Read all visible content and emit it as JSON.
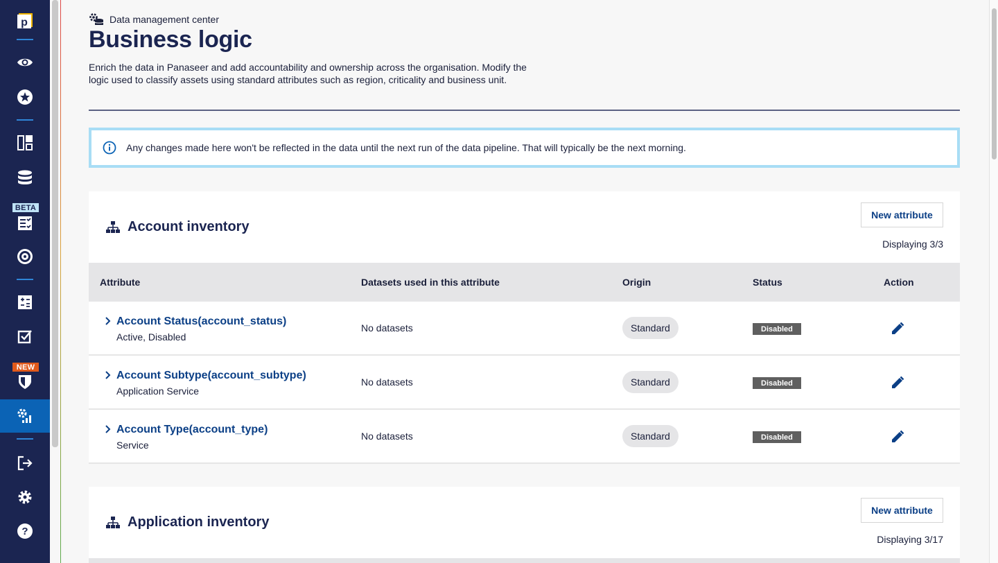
{
  "header": {
    "breadcrumb": "Data management center",
    "title": "Business logic",
    "description": "Enrich the data in Panaseer and add accountability and ownership across the organisation. Modify the logic used to classify assets using standard attributes such as region, criticality and business unit."
  },
  "info": {
    "message": "Any changes made here won't be reflected in the data until the next run of the data pipeline. That will typically be the next morning.",
    "icon": "info-icon"
  },
  "sidebar": {
    "logo_letter": "p",
    "beta_badge": "BETA",
    "new_badge": "NEW",
    "items": [
      {
        "icon": "eye-icon"
      },
      {
        "icon": "star-icon"
      },
      {
        "icon": "dashboard-icon"
      },
      {
        "icon": "database-icon"
      },
      {
        "icon": "checklist-icon"
      },
      {
        "icon": "target-icon"
      },
      {
        "icon": "calculator-icon"
      },
      {
        "icon": "checkbox-icon"
      },
      {
        "icon": "shield-icon"
      },
      {
        "icon": "data-management-icon"
      },
      {
        "icon": "logout-icon"
      },
      {
        "icon": "gear-icon"
      },
      {
        "icon": "help-icon"
      }
    ]
  },
  "table_columns": {
    "attribute": "Attribute",
    "datasets": "Datasets used in this attribute",
    "origin": "Origin",
    "status": "Status",
    "action": "Action"
  },
  "cards": [
    {
      "title": "Account inventory",
      "button": "New attribute",
      "count": "Displaying 3/3",
      "rows": [
        {
          "name": "Account Status(account_status)",
          "values": "Active, Disabled",
          "datasets": "No datasets",
          "origin": "Standard",
          "status": "Disabled"
        },
        {
          "name": "Account Subtype(account_subtype)",
          "values": "Application Service",
          "datasets": "No datasets",
          "origin": "Standard",
          "status": "Disabled"
        },
        {
          "name": "Account Type(account_type)",
          "values": "Service",
          "datasets": "No datasets",
          "origin": "Standard",
          "status": "Disabled"
        }
      ]
    },
    {
      "title": "Application inventory",
      "button": "New attribute",
      "count": "Displaying 3/17"
    }
  ],
  "colors": {
    "sidebar_bg": "#1b2551",
    "sidebar_active": "#0b63b5",
    "link": "#0b3f86",
    "info_border": "#a8ddf5",
    "status_bg": "#5f5f5f"
  }
}
